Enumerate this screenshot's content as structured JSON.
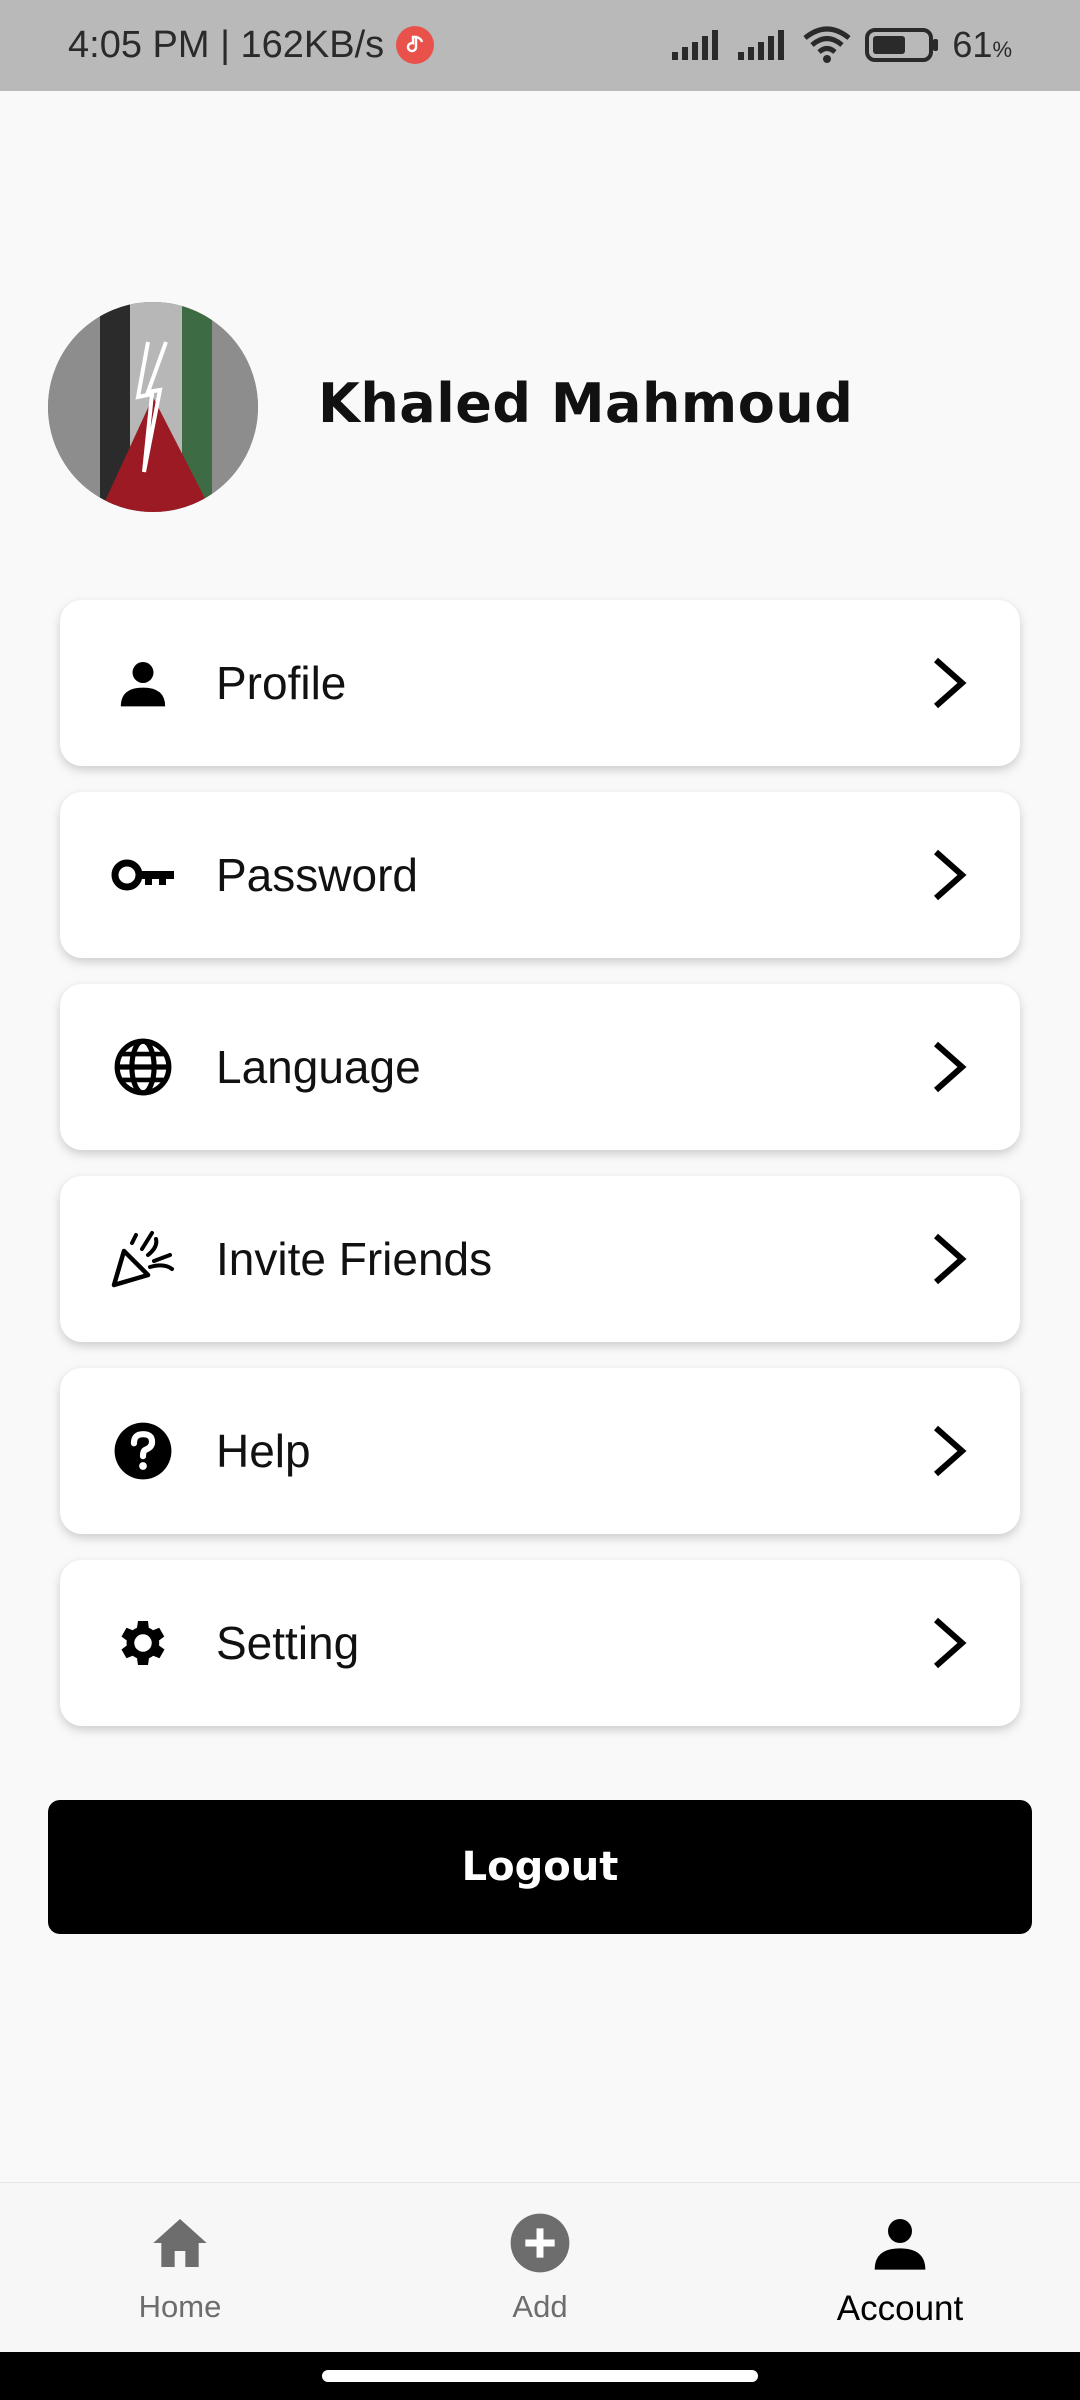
{
  "status_bar": {
    "time_speed": "4:05 PM | 162KB/s",
    "battery_percent": "61",
    "battery_unit": "%",
    "battery_level": 0.61
  },
  "user": {
    "name": "Khaled Mahmoud"
  },
  "menu": {
    "items": [
      {
        "label": "Profile",
        "icon": "person-icon"
      },
      {
        "label": "Password",
        "icon": "key-icon"
      },
      {
        "label": "Language",
        "icon": "globe-icon"
      },
      {
        "label": "Invite Friends",
        "icon": "party-popper-icon"
      },
      {
        "label": "Help",
        "icon": "help-icon"
      },
      {
        "label": "Setting",
        "icon": "gear-icon"
      }
    ]
  },
  "logout_label": "Logout",
  "bottom_nav": {
    "items": [
      {
        "label": "Home",
        "icon": "home-icon",
        "active": false
      },
      {
        "label": "Add",
        "icon": "add-circle-icon",
        "active": false
      },
      {
        "label": "Account",
        "icon": "account-icon",
        "active": true
      }
    ]
  },
  "colors": {
    "status_bar_bg": "#b9b9b9",
    "page_bg": "#f9f9f9",
    "logout_bg": "#000000",
    "music_badge": "#e8524a"
  }
}
